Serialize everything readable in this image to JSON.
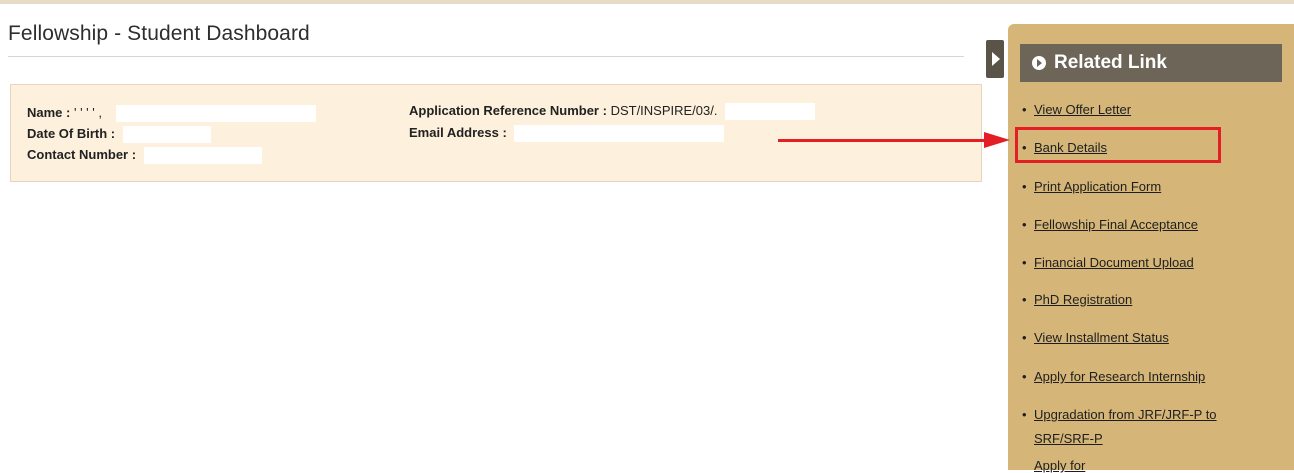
{
  "page": {
    "title": "Fellowship - Student Dashboard"
  },
  "student_info": {
    "name_label": "Name :",
    "name_value": "' ' ' ' ,",
    "dob_label": "Date Of Birth :",
    "contact_label": "Contact Number :",
    "app_ref_label": "Application Reference Number :",
    "app_ref_value": "DST/INSPIRE/03/.",
    "email_label": "Email Address :"
  },
  "sidebar": {
    "header": "Related Link",
    "links": [
      {
        "label": "View Offer Letter"
      },
      {
        "label": "Bank Details",
        "highlighted": true
      },
      {
        "label": "Print Application Form"
      },
      {
        "label": "Fellowship Final Acceptance"
      },
      {
        "label": "Financial Document Upload"
      },
      {
        "label": "PhD Registration"
      },
      {
        "label": "View Installment Status"
      },
      {
        "label": "Apply for Research Internship"
      },
      {
        "label_line1": "Upgradation from JRF/JRF-P to",
        "label_line2": "SRF/SRF-P"
      },
      {
        "label": "Apply for"
      }
    ]
  },
  "colors": {
    "sidebar_bg": "#d5b678",
    "sidebar_header_bg": "#6c6558",
    "info_box_bg": "#fdf0dc",
    "annotation_red": "#e31e24"
  }
}
